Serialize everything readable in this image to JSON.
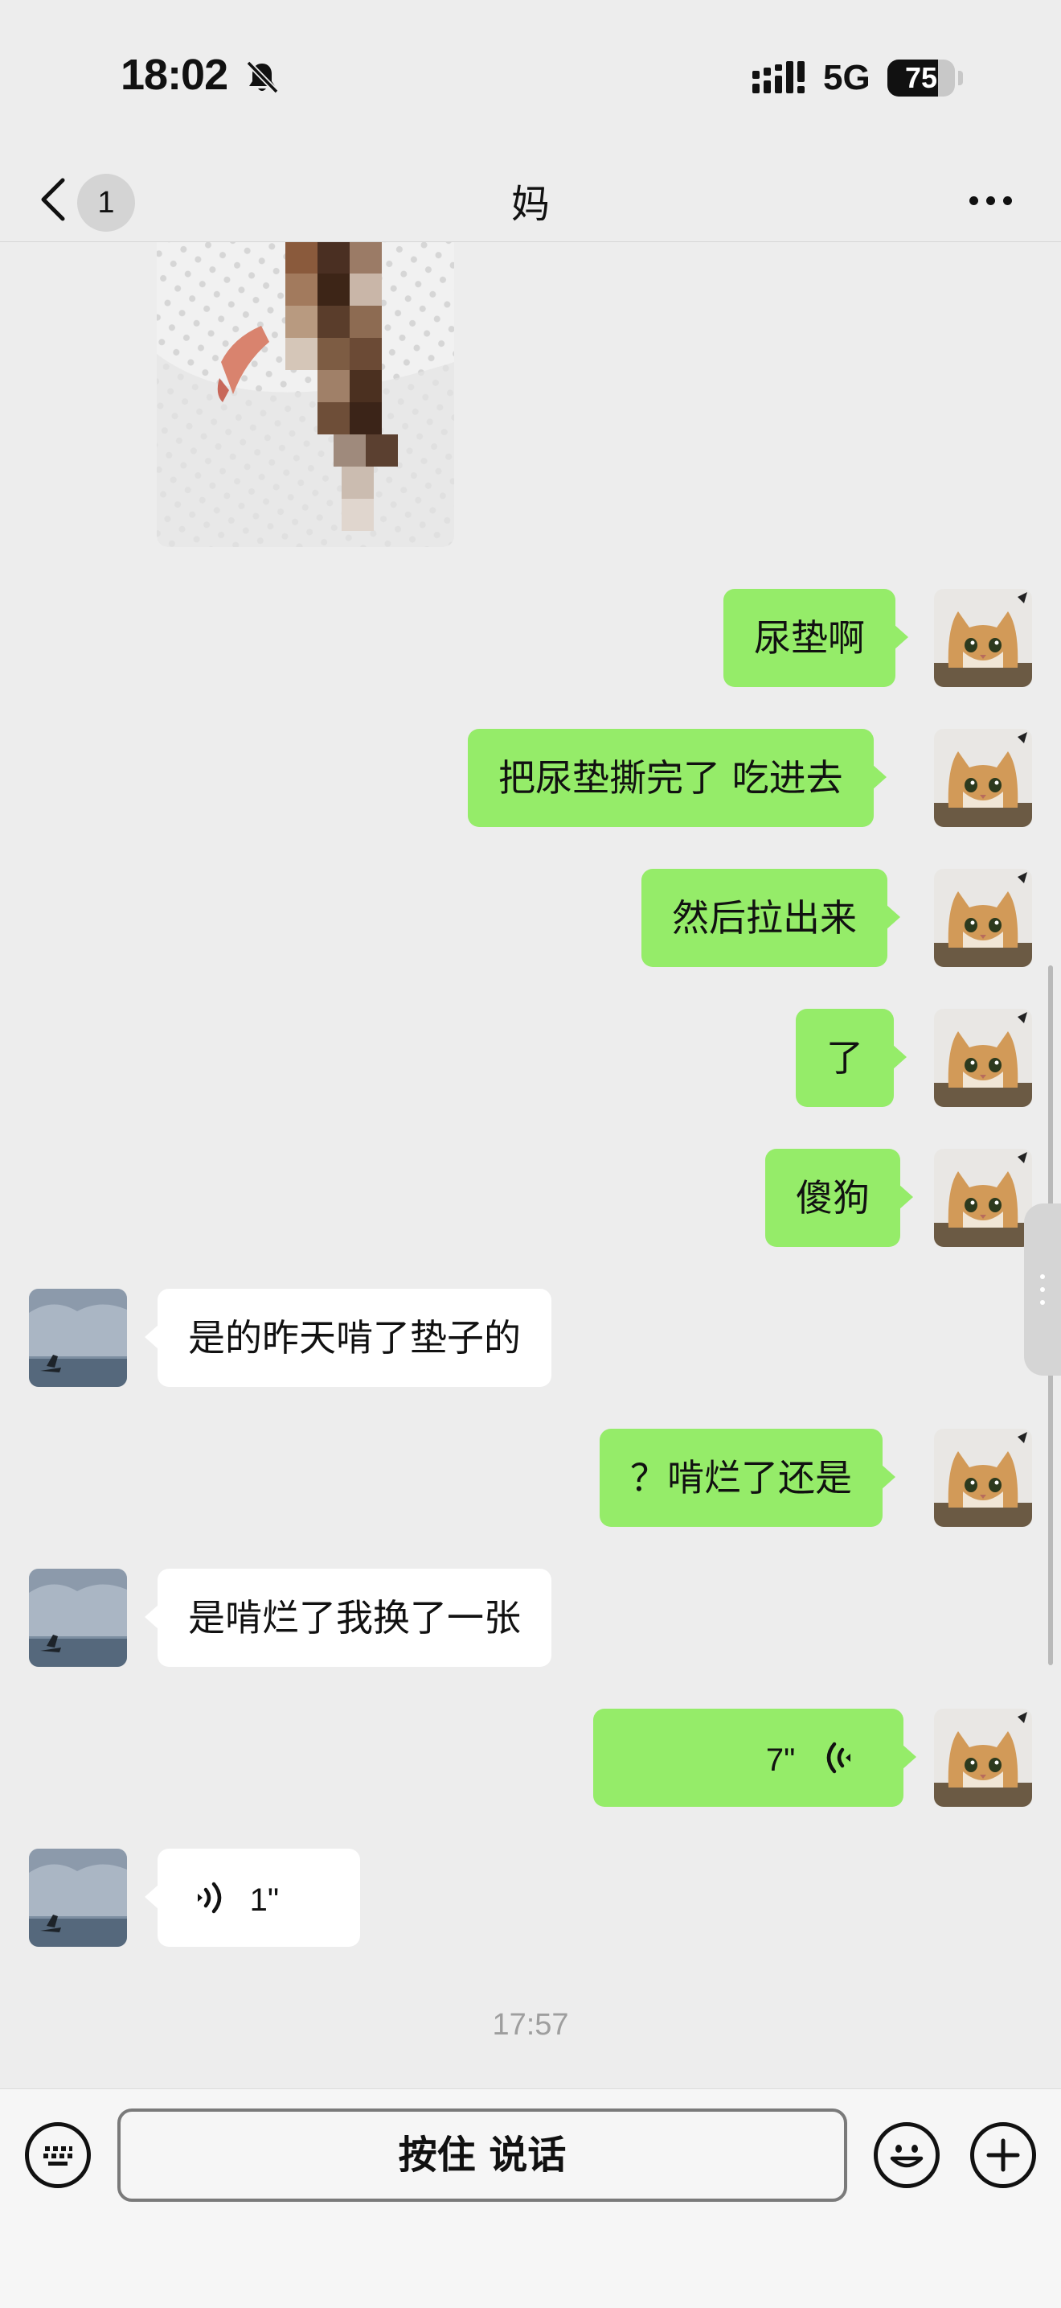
{
  "status_bar": {
    "time": "18:02",
    "network": "5G",
    "battery": "75",
    "battery_fraction": 0.75,
    "icons": [
      "mute-bell-icon",
      "signal-icon",
      "battery-icon"
    ]
  },
  "nav": {
    "back_badge": "1",
    "title": "妈",
    "icons": [
      "chevron-left-icon",
      "more-dots-icon"
    ]
  },
  "messages": [
    {
      "side": "received",
      "type": "image",
      "note": "blurred photo"
    },
    {
      "side": "sent",
      "type": "text",
      "text": "尿垫啊"
    },
    {
      "side": "sent",
      "type": "text",
      "text": "把尿垫撕完了 吃进去"
    },
    {
      "side": "sent",
      "type": "text",
      "text": "然后拉出来"
    },
    {
      "side": "sent",
      "type": "text",
      "text": "了"
    },
    {
      "side": "sent",
      "type": "text",
      "text": "傻狗"
    },
    {
      "side": "received",
      "type": "text",
      "text": "是的昨天啃了垫子的"
    },
    {
      "side": "sent",
      "type": "text",
      "text": "？啃烂了还是"
    },
    {
      "side": "received",
      "type": "text",
      "text": "是啃烂了我换了一张"
    },
    {
      "side": "sent",
      "type": "voice",
      "duration": "7\""
    },
    {
      "side": "received",
      "type": "voice",
      "duration": "1\""
    }
  ],
  "timestamp": "17:57",
  "input_bar": {
    "talk_label": "按住 说话",
    "icons": [
      "keyboard-icon",
      "emoji-icon",
      "plus-icon"
    ]
  },
  "colors": {
    "background": "#ededed",
    "sent_bubble": "#95ec69",
    "received_bubble": "#ffffff"
  }
}
